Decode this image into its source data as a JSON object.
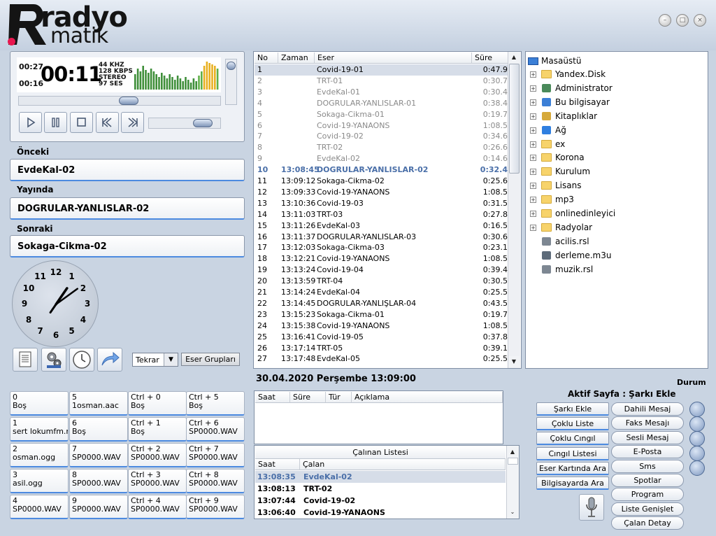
{
  "app": {
    "logo_word1": "radyo",
    "logo_word2": "matik",
    "window_buttons": [
      "minimize-icon",
      "maximize-icon",
      "close-icon"
    ]
  },
  "player": {
    "elapsed": "00:27",
    "remaining": "00:16",
    "big_time": "00:11",
    "khz": "44 KHZ",
    "kbps": "128 KBPS",
    "mode": "STEREO",
    "volume": "97 SES",
    "seek_fraction": 0.55,
    "volume_fraction": 0.85,
    "buttons": [
      "play-icon",
      "pause-icon",
      "stop-icon",
      "previous-icon",
      "next-icon"
    ]
  },
  "nowplaying": {
    "prev_label": "Önceki",
    "prev_value": "EvdeKal-02",
    "cur_label": "Yayında",
    "cur_value": "DOGRULAR-YANLISLAR-02",
    "next_label": "Sonraki",
    "next_value": "Sokaga-Cikma-02"
  },
  "clock": {
    "numbers": [
      "12",
      "1",
      "2",
      "3",
      "4",
      "5",
      "6",
      "7",
      "8",
      "9",
      "10",
      "11"
    ],
    "hour": 13,
    "minute": 9
  },
  "tools": {
    "icons": [
      "notepad-icon",
      "gears-icon",
      "stopwatch-icon",
      "redo-arrow-icon"
    ],
    "repeat_select": "Tekrar",
    "groups_button": "Eser Grupları"
  },
  "playlist": {
    "columns": [
      "No",
      "Zaman",
      "Eser",
      "Süre"
    ],
    "rows": [
      {
        "no": "1",
        "time": "",
        "title": "Covid-19-01",
        "dur": "0:47.9",
        "state": "sel"
      },
      {
        "no": "2",
        "time": "",
        "title": "TRT-01",
        "dur": "0:30.7",
        "state": "past"
      },
      {
        "no": "3",
        "time": "",
        "title": "EvdeKal-01",
        "dur": "0:30.4",
        "state": "past"
      },
      {
        "no": "4",
        "time": "",
        "title": "DOGRULAR-YANLISLAR-01",
        "dur": "0:38.4",
        "state": "past"
      },
      {
        "no": "5",
        "time": "",
        "title": "Sokaga-Cikma-01",
        "dur": "0:19.7",
        "state": "past"
      },
      {
        "no": "6",
        "time": "",
        "title": "Covid-19-YANAONS",
        "dur": "1:08.5",
        "state": "past"
      },
      {
        "no": "7",
        "time": "",
        "title": "Covid-19-02",
        "dur": "0:34.6",
        "state": "past"
      },
      {
        "no": "8",
        "time": "",
        "title": "TRT-02",
        "dur": "0:26.6",
        "state": "past"
      },
      {
        "no": "9",
        "time": "",
        "title": "EvdeKal-02",
        "dur": "0:14.6",
        "state": "past"
      },
      {
        "no": "10",
        "time": "13:08:45",
        "title": "DOGRULAR-YANLISLAR-02",
        "dur": "0:32.4",
        "state": "cur"
      },
      {
        "no": "11",
        "time": "13:09:12",
        "title": "Sokaga-Cikma-02",
        "dur": "0:25.6",
        "state": ""
      },
      {
        "no": "12",
        "time": "13:09:33",
        "title": "Covid-19-YANAONS",
        "dur": "1:08.5",
        "state": ""
      },
      {
        "no": "13",
        "time": "13:10:36",
        "title": "Covid-19-03",
        "dur": "0:31.5",
        "state": ""
      },
      {
        "no": "14",
        "time": "13:11:03",
        "title": "TRT-03",
        "dur": "0:27.8",
        "state": ""
      },
      {
        "no": "15",
        "time": "13:11:26",
        "title": "EvdeKal-03",
        "dur": "0:16.5",
        "state": ""
      },
      {
        "no": "16",
        "time": "13:11:37",
        "title": "DOGRULAR-YANLISLAR-03",
        "dur": "0:30.6",
        "state": ""
      },
      {
        "no": "17",
        "time": "13:12:03",
        "title": "Sokaga-Cikma-03",
        "dur": "0:23.1",
        "state": ""
      },
      {
        "no": "18",
        "time": "13:12:21",
        "title": "Covid-19-YANAONS",
        "dur": "1:08.5",
        "state": ""
      },
      {
        "no": "19",
        "time": "13:13:24",
        "title": "Covid-19-04",
        "dur": "0:39.4",
        "state": ""
      },
      {
        "no": "20",
        "time": "13:13:59",
        "title": "TRT-04",
        "dur": "0:30.5",
        "state": ""
      },
      {
        "no": "21",
        "time": "13:14:24",
        "title": "EvdeKal-04",
        "dur": "0:25.5",
        "state": ""
      },
      {
        "no": "22",
        "time": "13:14:45",
        "title": "DOGRULAR-YANLIŞLAR-04",
        "dur": "0:43.5",
        "state": ""
      },
      {
        "no": "23",
        "time": "13:15:23",
        "title": "Sokaga-Cikma-01",
        "dur": "0:19.7",
        "state": ""
      },
      {
        "no": "24",
        "time": "13:15:38",
        "title": "Covid-19-YANAONS",
        "dur": "1:08.5",
        "state": ""
      },
      {
        "no": "25",
        "time": "13:16:41",
        "title": "Covid-19-05",
        "dur": "0:37.8",
        "state": ""
      },
      {
        "no": "26",
        "time": "13:17:14",
        "title": "TRT-05",
        "dur": "0:39.1",
        "state": ""
      },
      {
        "no": "27",
        "time": "13:17:48",
        "title": "EvdeKal-05",
        "dur": "0:25.5",
        "state": ""
      }
    ]
  },
  "tree": {
    "root": "Masaüstü",
    "items": [
      {
        "label": "Yandex.Disk",
        "icon": "folder-icon",
        "expand": true
      },
      {
        "label": "Administrator",
        "icon": "user-icon",
        "expand": true
      },
      {
        "label": "Bu bilgisayar",
        "icon": "computer-icon",
        "expand": true
      },
      {
        "label": "Kitaplıklar",
        "icon": "library-icon",
        "expand": true
      },
      {
        "label": "Ağ",
        "icon": "network-icon",
        "expand": true
      },
      {
        "label": "ex",
        "icon": "folder-icon",
        "expand": true
      },
      {
        "label": "Korona",
        "icon": "folder-icon",
        "expand": true
      },
      {
        "label": "Kurulum",
        "icon": "folder-icon",
        "expand": true
      },
      {
        "label": "Lisans",
        "icon": "folder-icon",
        "expand": true
      },
      {
        "label": "mp3",
        "icon": "folder-icon",
        "expand": true
      },
      {
        "label": "onlinedinleyici",
        "icon": "folder-icon",
        "expand": true
      },
      {
        "label": "Radyolar",
        "icon": "folder-icon",
        "expand": true
      },
      {
        "label": "acilis.rsl",
        "icon": "rsl-file-icon",
        "expand": false
      },
      {
        "label": "derleme.m3u",
        "icon": "m3u-file-icon",
        "expand": false
      },
      {
        "label": "muzik.rsl",
        "icon": "rsl-file-icon",
        "expand": false
      }
    ]
  },
  "status": {
    "date": "30.04.2020 Perşembe 13:09:00",
    "durum_label": "Durum",
    "active_page": "Aktif Sayfa : Şarkı Ekle"
  },
  "hotkeys": [
    [
      {
        "key": "0",
        "val": "Boş"
      },
      {
        "key": "5",
        "val": "1osman.aac"
      },
      {
        "key": "Ctrl + 0",
        "val": "Boş"
      },
      {
        "key": "Ctrl + 5",
        "val": "Boş"
      }
    ],
    [
      {
        "key": "1",
        "val": "sert lokumfm.mp3"
      },
      {
        "key": "6",
        "val": "Boş"
      },
      {
        "key": "Ctrl + 1",
        "val": "Boş"
      },
      {
        "key": "Ctrl + 6",
        "val": "SP0000.WAV"
      }
    ],
    [
      {
        "key": "2",
        "val": "osman.ogg"
      },
      {
        "key": "7",
        "val": "SP0000.WAV"
      },
      {
        "key": "Ctrl + 2",
        "val": "SP0000.WAV"
      },
      {
        "key": "Ctrl + 7",
        "val": "SP0000.WAV"
      }
    ],
    [
      {
        "key": "3",
        "val": "asil.ogg"
      },
      {
        "key": "8",
        "val": "SP0000.WAV"
      },
      {
        "key": "Ctrl + 3",
        "val": "SP0000.WAV"
      },
      {
        "key": "Ctrl + 8",
        "val": "SP0000.WAV"
      }
    ],
    [
      {
        "key": "4",
        "val": "SP0000.WAV"
      },
      {
        "key": "9",
        "val": "SP0000.WAV"
      },
      {
        "key": "Ctrl + 4",
        "val": "SP0000.WAV"
      },
      {
        "key": "Ctrl + 9",
        "val": "SP0000.WAV"
      }
    ]
  ],
  "messages": {
    "columns": [
      "Saat",
      "Süre",
      "Tür",
      "Açıklama"
    ]
  },
  "history": {
    "title": "Çalınan Listesi",
    "columns": [
      "Saat",
      "Çalan"
    ],
    "rows": [
      {
        "time": "13:08:35",
        "title": "EvdeKal-02",
        "state": "sel"
      },
      {
        "time": "13:08:13",
        "title": "TRT-02",
        "state": ""
      },
      {
        "time": "13:07:44",
        "title": "Covid-19-02",
        "state": ""
      },
      {
        "time": "13:06:40",
        "title": "Covid-19-YANAONS",
        "state": ""
      }
    ]
  },
  "right_buttons": {
    "left": [
      "Şarkı Ekle",
      "Çoklu Liste",
      "Çoklu Cıngıl",
      "Cıngıl Listesi",
      "Eser Kartında Ara",
      "Bilgisayarda Ara"
    ],
    "right": [
      "Dahili Mesaj",
      "Faks Mesajı",
      "Sesli Mesaj",
      "E-Posta",
      "Sms",
      "Spotlar",
      "Program",
      "Liste Genişlet",
      "Çalan Detay"
    ],
    "mic_icon": "microphone-icon"
  }
}
